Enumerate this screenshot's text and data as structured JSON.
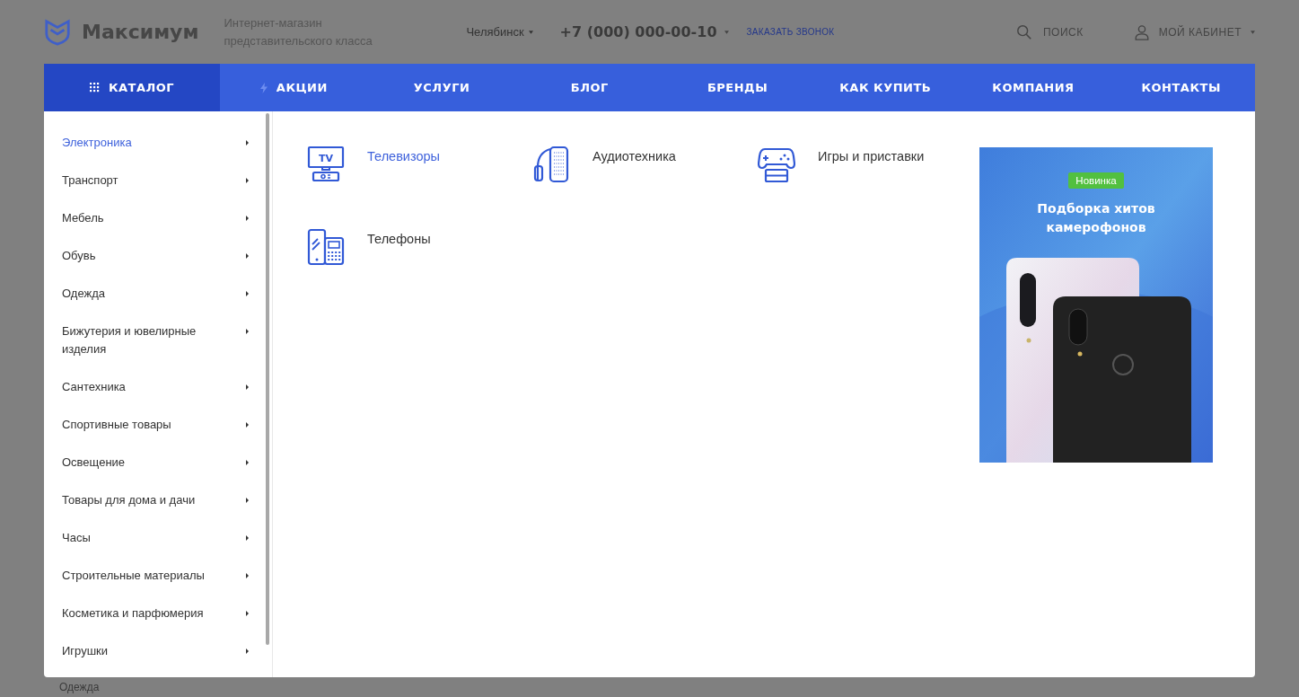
{
  "header": {
    "logo": "Максимум",
    "tagline": "Интернет-магазин представительского класса",
    "city": "Челябинск",
    "phone": "+7 (000) 000-00-10",
    "callback": "ЗАКАЗАТЬ ЗВОНОК",
    "search": "ПОИСК",
    "account": "МОЙ КАБИНЕТ"
  },
  "nav": [
    {
      "label": "КАТАЛОГ",
      "kind": "catalog",
      "selected": true
    },
    {
      "label": "АКЦИИ",
      "kind": "sale",
      "selected": false
    },
    {
      "label": "УСЛУГИ",
      "kind": "plain",
      "selected": false
    },
    {
      "label": "БЛОГ",
      "kind": "plain",
      "selected": false
    },
    {
      "label": "БРЕНДЫ",
      "kind": "plain",
      "selected": false
    },
    {
      "label": "КАК КУПИТЬ",
      "kind": "plain",
      "selected": false
    },
    {
      "label": "КОМПАНИЯ",
      "kind": "plain",
      "selected": false
    },
    {
      "label": "КОНТАКТЫ",
      "kind": "plain",
      "selected": false
    }
  ],
  "categories": [
    {
      "label": "Электроника",
      "selected": true
    },
    {
      "label": "Транспорт",
      "selected": false
    },
    {
      "label": "Мебель",
      "selected": false
    },
    {
      "label": "Обувь",
      "selected": false
    },
    {
      "label": "Одежда",
      "selected": false
    },
    {
      "label": "Бижутерия и ювелирные изделия",
      "selected": false
    },
    {
      "label": "Сантехника",
      "selected": false
    },
    {
      "label": "Спортивные товары",
      "selected": false
    },
    {
      "label": "Освещение",
      "selected": false
    },
    {
      "label": "Товары для дома и дачи",
      "selected": false
    },
    {
      "label": "Часы",
      "selected": false
    },
    {
      "label": "Строительные материалы",
      "selected": false
    },
    {
      "label": "Косметика и парфюмерия",
      "selected": false
    },
    {
      "label": "Игрушки",
      "selected": false
    }
  ],
  "subcategories": [
    {
      "label": "Телевизоры",
      "kind": "tv",
      "icon_text": "TV",
      "selected": true
    },
    {
      "label": "Аудиотехника",
      "kind": "audio",
      "selected": false
    },
    {
      "label": "Игры и приставки",
      "kind": "games",
      "selected": false
    },
    {
      "label": "Телефоны",
      "kind": "phones",
      "selected": false
    }
  ],
  "banner": {
    "badge": "Новинка",
    "title": "Подборка хитов камерофонов"
  },
  "background_item": "Одежда"
}
